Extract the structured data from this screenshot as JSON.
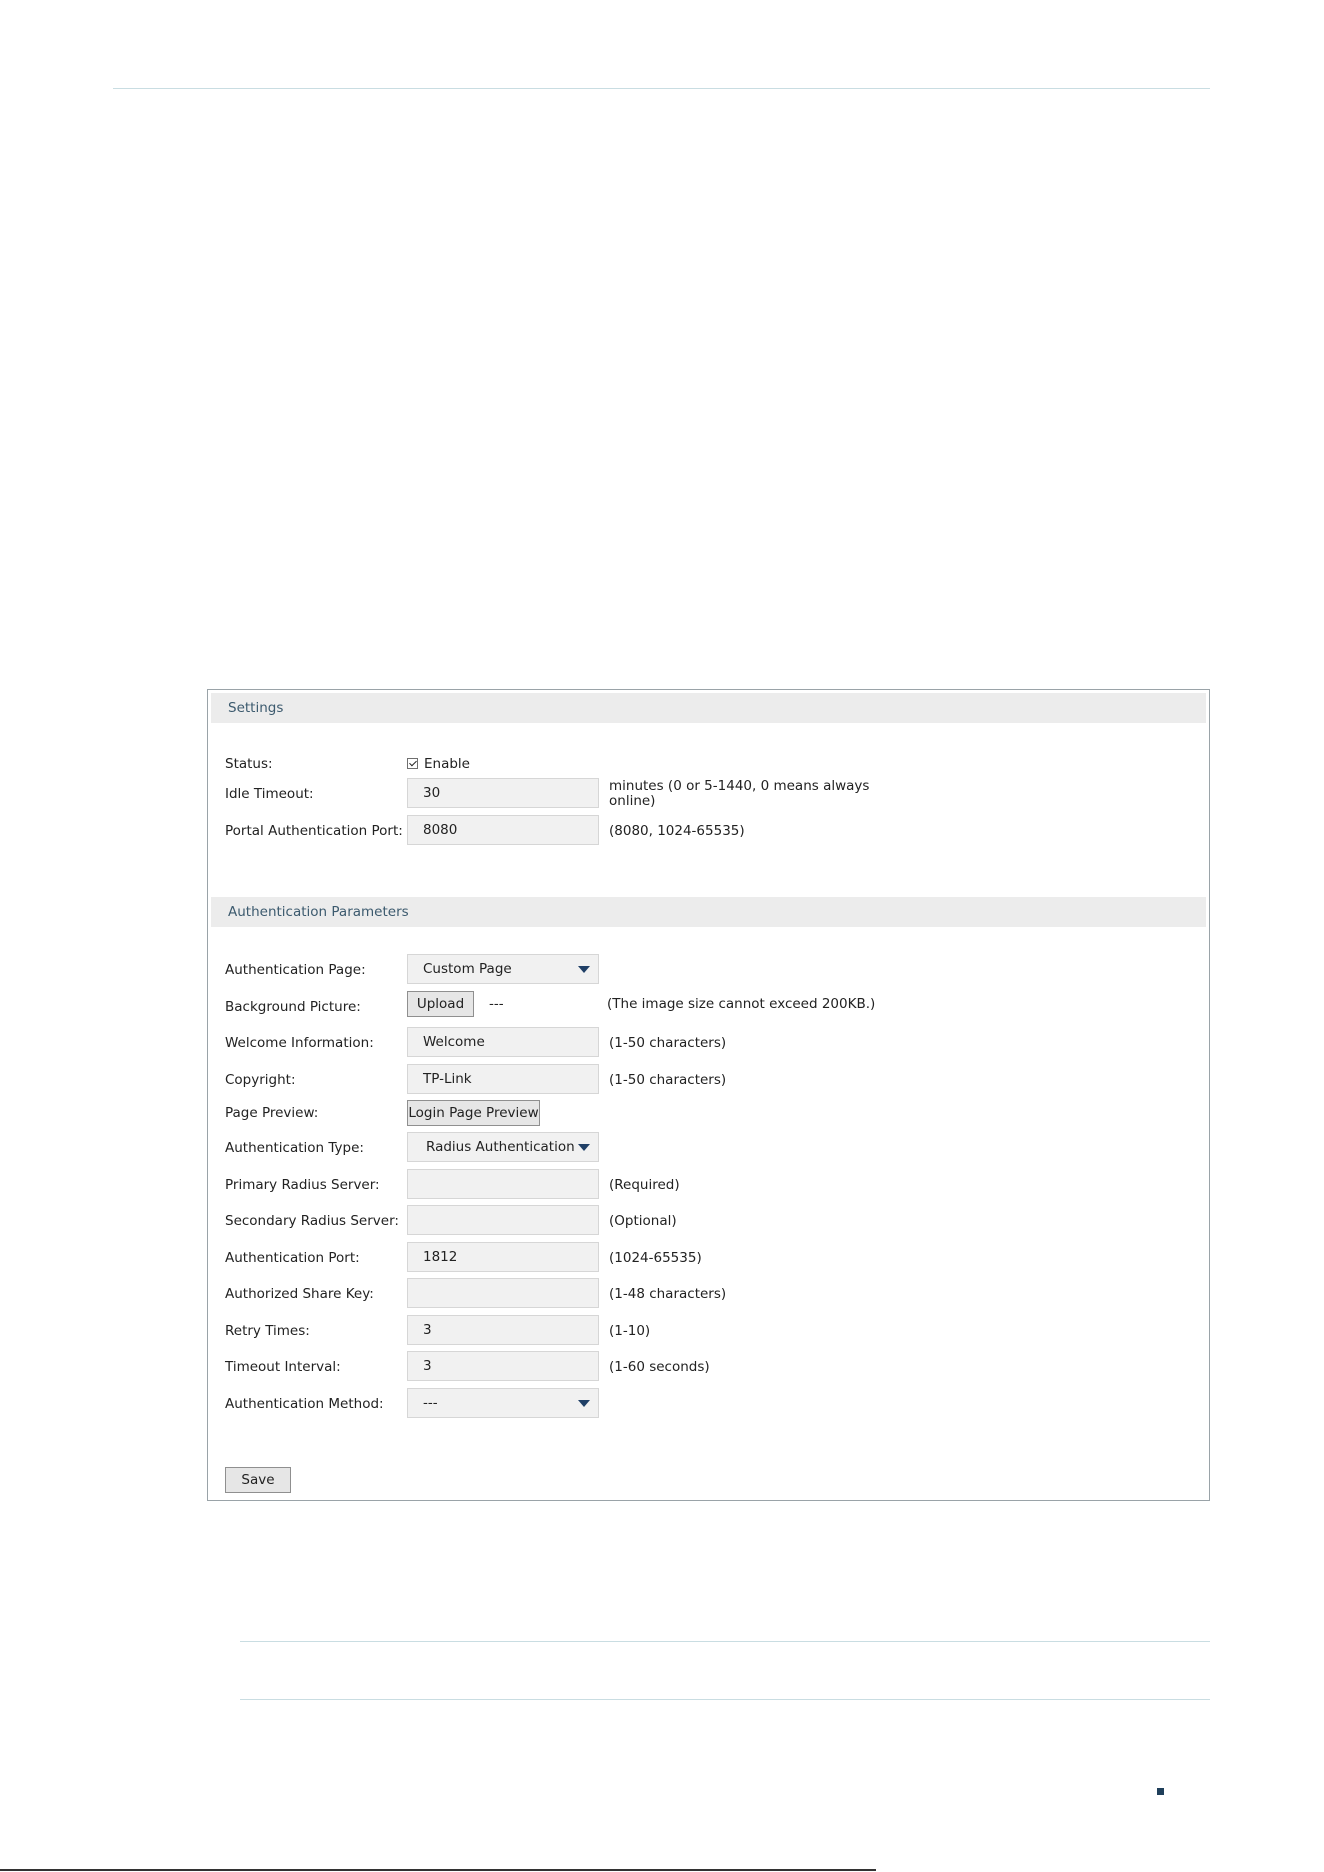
{
  "settings": {
    "header": "Settings",
    "status_label": "Status:",
    "status_enable_label": "Enable",
    "idle_timeout_label": "Idle Timeout:",
    "idle_timeout_value": "30",
    "idle_timeout_hint_line1": "minutes (0 or 5-1440, 0 means always",
    "idle_timeout_hint_line2": "online)",
    "portal_port_label": "Portal Authentication Port:",
    "portal_port_value": "8080",
    "portal_port_hint": "(8080, 1024-65535)"
  },
  "auth": {
    "header": "Authentication Parameters",
    "page_label": "Authentication Page:",
    "page_value": "Custom Page",
    "background_label": "Background Picture:",
    "upload_button": "Upload",
    "background_value": "---",
    "background_hint": "(The image size cannot exceed 200KB.)",
    "welcome_label": "Welcome Information:",
    "welcome_value": "Welcome",
    "welcome_hint": "(1-50 characters)",
    "copyright_label": "Copyright:",
    "copyright_value": "TP-Link",
    "copyright_hint": "(1-50 characters)",
    "preview_label": "Page Preview:",
    "preview_button": "Login Page Preview",
    "type_label": "Authentication Type:",
    "type_value": "Radius Authentication",
    "primary_label": "Primary Radius Server:",
    "primary_value": "",
    "primary_hint": "(Required)",
    "secondary_label": "Secondary Radius Server:",
    "secondary_value": "",
    "secondary_hint": "(Optional)",
    "port_label": "Authentication Port:",
    "port_value": "1812",
    "port_hint": "(1024-65535)",
    "share_key_label": "Authorized Share Key:",
    "share_key_value": "",
    "share_key_hint": "(1-48 characters)",
    "retry_label": "Retry Times:",
    "retry_value": "3",
    "retry_hint": "(1-10)",
    "timeout_label": "Timeout Interval:",
    "timeout_value": "3",
    "timeout_hint": "(1-60 seconds)",
    "method_label": "Authentication Method:",
    "method_value": "---"
  },
  "save_button": "Save",
  "icons": {
    "dropdown": "caret-down-icon",
    "checkbox": "checkmark-icon"
  },
  "colors": {
    "header_bg": "#ececec",
    "header_text": "#3c5a6e",
    "field_bg": "#f1f1f1",
    "caret": "#1f3f66"
  }
}
